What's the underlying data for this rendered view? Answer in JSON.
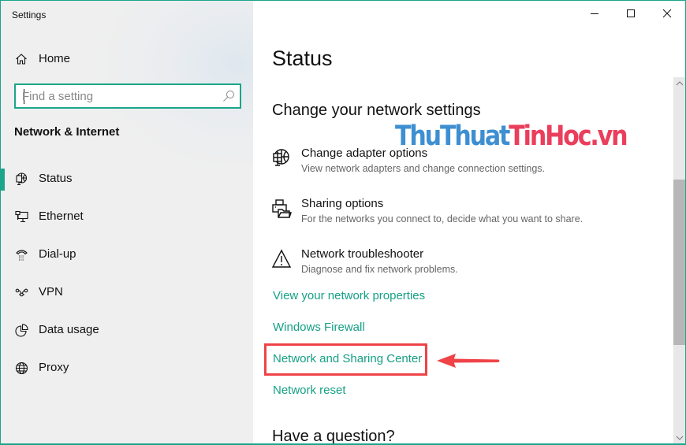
{
  "window": {
    "title": "Settings",
    "accent_color": "#1ba58a",
    "controls": {
      "minimize_icon": "minimize-icon",
      "maximize_icon": "maximize-icon",
      "close_icon": "close-icon"
    }
  },
  "sidebar": {
    "home_label": "Home",
    "search": {
      "placeholder": "Find a setting",
      "value": ""
    },
    "section_title": "Network & Internet",
    "items": [
      {
        "label": "Status",
        "icon": "globe-monitor-icon",
        "active": true
      },
      {
        "label": "Ethernet",
        "icon": "ethernet-icon",
        "active": false
      },
      {
        "label": "Dial-up",
        "icon": "phone-icon",
        "active": false
      },
      {
        "label": "VPN",
        "icon": "vpn-icon",
        "active": false
      },
      {
        "label": "Data usage",
        "icon": "pie-chart-icon",
        "active": false
      },
      {
        "label": "Proxy",
        "icon": "globe-icon",
        "active": false
      }
    ]
  },
  "main": {
    "page_title": "Status",
    "section_heading": "Change your network settings",
    "options": [
      {
        "title": "Change adapter options",
        "description": "View network adapters and change connection settings.",
        "icon": "globe-monitor-icon"
      },
      {
        "title": "Sharing options",
        "description": "For the networks you connect to, decide what you want to share.",
        "icon": "printer-folder-icon"
      },
      {
        "title": "Network troubleshooter",
        "description": "Diagnose and fix network problems.",
        "icon": "warning-icon"
      }
    ],
    "links": [
      {
        "label": "View your network properties"
      },
      {
        "label": "Windows Firewall"
      },
      {
        "label": "Network and Sharing Center",
        "highlighted": true
      },
      {
        "label": "Network reset"
      }
    ],
    "question_heading": "Have a question?",
    "link_color": "#16a085"
  },
  "annotation": {
    "highlight_color": "#ef4348",
    "watermark_part1": "ThuThuat",
    "watermark_part2": "TinHoc.vn",
    "watermark_color1": "#3e8fd1",
    "watermark_color2": "#ea3e5c"
  }
}
